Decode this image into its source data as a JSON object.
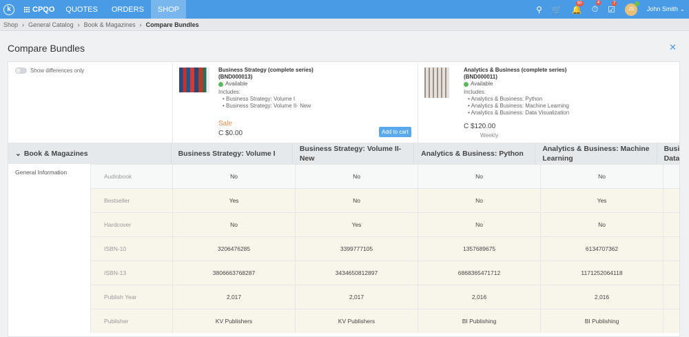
{
  "topbar": {
    "brand": "CPQO",
    "nav": [
      "QUOTES",
      "ORDERS",
      "SHOP"
    ],
    "badges": {
      "notifications": "50",
      "tasks": "4",
      "approvals": "7"
    },
    "avatar_initials": "JS",
    "user": "John Smith"
  },
  "breadcrumb": [
    "Shop",
    "General Catalog",
    "Book & Magazines",
    "Compare Bundles"
  ],
  "page": {
    "title": "Compare Bundles",
    "toggle_label": "Show differences only"
  },
  "products": [
    {
      "name": "Business Strategy (complete series)",
      "code": "(BND000013)",
      "status": "Available",
      "includes_label": "Includes:",
      "includes": [
        "Business Strategy: Volume I",
        "Business Strategy: Volume II- New"
      ],
      "sale": "Sale",
      "price": "C $0.00",
      "cart": "Add to cart"
    },
    {
      "name": "Analytics & Business (complete series)",
      "code": "(BND000011)",
      "status": "Available",
      "includes_label": "Includes:",
      "includes": [
        "Analytics & Business: Python",
        "Analytics & Business: Machine Learning",
        "Analytics & Business: Data Visualization"
      ],
      "price": "C $120.00",
      "period": "Weekly"
    }
  ],
  "table": {
    "category": "Book & Magazines",
    "group": "General Information",
    "columns": [
      "Business Strategy: Volume I",
      "Business Strategy: Volume II- New",
      "Analytics & Business: Python",
      "Analytics & Business: Machine Learning",
      "Analytics & Business: Data Visualization"
    ],
    "rows": [
      {
        "label": "Audiobook",
        "values": [
          "No",
          "No",
          "No",
          "No",
          ""
        ],
        "diff": false
      },
      {
        "label": "Bestseller",
        "values": [
          "Yes",
          "No",
          "No",
          "Yes",
          ""
        ],
        "diff": true
      },
      {
        "label": "Hardcover",
        "values": [
          "No",
          "Yes",
          "No",
          "No",
          ""
        ],
        "diff": true
      },
      {
        "label": "ISBN-10",
        "values": [
          "3206476285",
          "3399777105",
          "1357689675",
          "6134707362",
          ""
        ],
        "diff": true
      },
      {
        "label": "ISBN-13",
        "values": [
          "3806663768287",
          "3434650812897",
          "6868365471712",
          "1171252064118",
          ""
        ],
        "diff": true
      },
      {
        "label": "Publish Year",
        "values": [
          "2,017",
          "2,017",
          "2,016",
          "2,016",
          ""
        ],
        "diff": true
      },
      {
        "label": "Publisher",
        "values": [
          "KV Publishers",
          "KV Publishers",
          "BI Publishing",
          "BI Publishing",
          ""
        ],
        "diff": true
      }
    ]
  }
}
